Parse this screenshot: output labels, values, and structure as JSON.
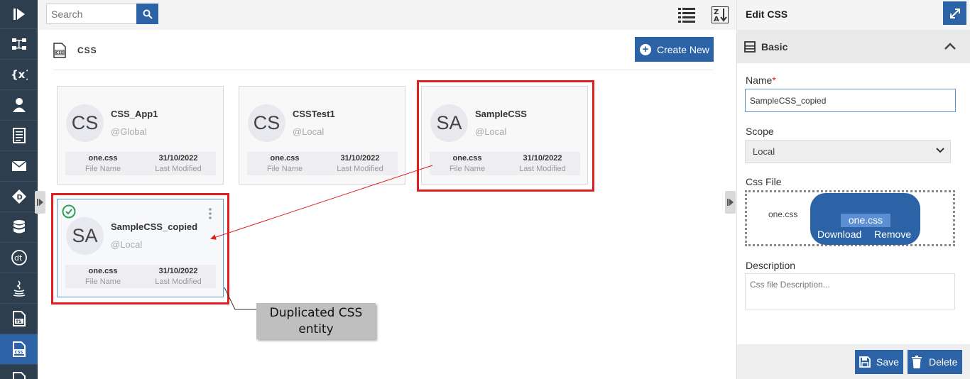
{
  "search": {
    "placeholder": "Search"
  },
  "section": {
    "title": "CSS",
    "create_label": "Create New"
  },
  "cards": [
    {
      "initials": "CS",
      "name": "CSS_App1",
      "scope": "@Global",
      "file_name": "one.css",
      "file_label": "File Name",
      "modified": "31/10/2022",
      "modified_label": "Last Modified"
    },
    {
      "initials": "CS",
      "name": "CSSTest1",
      "scope": "@Local",
      "file_name": "one.css",
      "file_label": "File Name",
      "modified": "31/10/2022",
      "modified_label": "Last Modified"
    },
    {
      "initials": "SA",
      "name": "SampleCSS",
      "scope": "@Local",
      "file_name": "one.css",
      "file_label": "File Name",
      "modified": "31/10/2022",
      "modified_label": "Last Modified"
    },
    {
      "initials": "SA",
      "name": "SampleCSS_copied",
      "scope": "@Local",
      "file_name": "one.css",
      "file_label": "File Name",
      "modified": "31/10/2022",
      "modified_label": "Last Modified"
    }
  ],
  "annotation": {
    "line1": "Duplicated CSS",
    "line2": "entity"
  },
  "panel": {
    "title": "Edit CSS",
    "section": "Basic",
    "name_label": "Name",
    "required_mark": "*",
    "name_value": "SampleCSS_copied",
    "scope_label": "Scope",
    "scope_value": "Local",
    "css_file_label": "Css File",
    "css_file_name": "one.css",
    "pill_file": "one.css",
    "download_label": "Download",
    "remove_label": "Remove",
    "description_label": "Description",
    "description_placeholder": "Css file Description...",
    "save_label": "Save",
    "delete_label": "Delete"
  },
  "sidebar": {
    "icons": [
      "play-logo-icon",
      "workflow-icon",
      "variables-icon",
      "user-icon",
      "document-icon",
      "mail-icon",
      "diamond-icon",
      "database-icon",
      "dt-icon",
      "java-icon",
      "ts-file-icon",
      "css-file-icon",
      "text-file-icon"
    ],
    "active": "css-file-icon"
  },
  "colors": {
    "accent": "#2b63a6",
    "rail": "#2d3e4f",
    "highlight": "#e02020"
  }
}
